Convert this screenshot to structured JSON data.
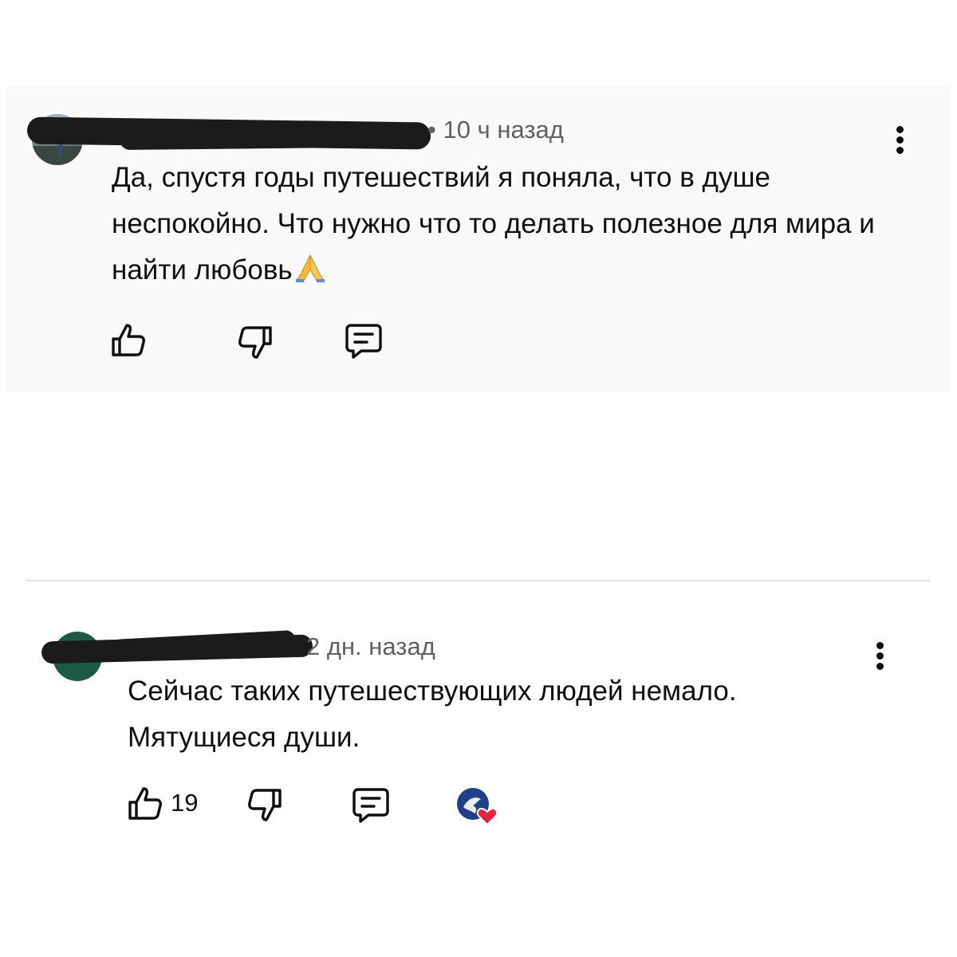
{
  "comments": [
    {
      "time": "• 10 ч назад",
      "text": "Да, спустя годы путешествий я поняла, что в душе неспокойно. Что нужно что то делать полезное для мира и найти любовь",
      "emoji": "🙏",
      "like_count": "",
      "icons": [
        "thumbs-up-icon",
        "thumbs-down-icon",
        "reply-icon",
        "more-vert-icon"
      ]
    },
    {
      "time": "2 дн. назад",
      "text_line1": "Сейчас таких путешествующих людей немало.",
      "text_line2": "Мятущиеся души.",
      "like_count": "19",
      "icons": [
        "thumbs-up-icon",
        "thumbs-down-icon",
        "reply-icon",
        "creator-heart-icon",
        "more-vert-icon"
      ]
    }
  ],
  "colors": {
    "card_background": "#f9f9f9",
    "text": "#0f0f0f",
    "meta_text": "#606060",
    "heart": "#e8213d",
    "avatar2": "#1c5a46"
  }
}
